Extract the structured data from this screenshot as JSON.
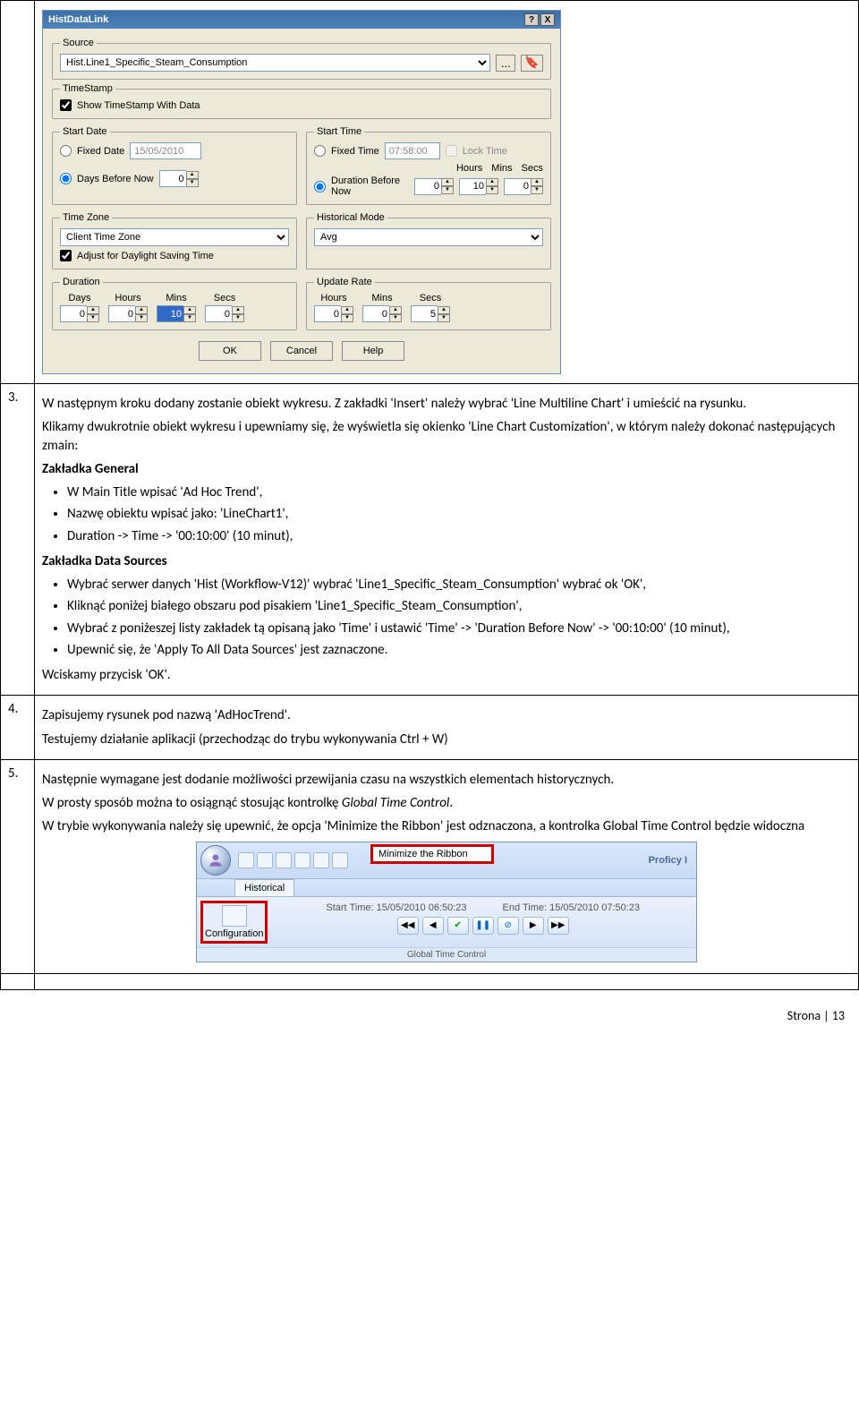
{
  "rows": {
    "r3": {
      "num": "3.",
      "intro": "W następnym kroku dodany zostanie obiekt wykresu. Z zakładki 'Insert' należy wybrać 'Line Multiline Chart' i umieścić na rysunku.",
      "p2": "Klikamy dwukrotnie obiekt wykresu i upewniamy się, że wyświetla się okienko 'Line Chart Customization', w którym należy dokonać następujących zmain:",
      "h_general": "Zakładka General",
      "gen_b1": "W Main Title wpisać 'Ad Hoc Trend',",
      "gen_b2": "Nazwę obiektu wpisać jako: 'LineChart1',",
      "gen_b3": "Duration -> Time -> '00:10:00' (10 minut),",
      "h_ds": "Zakładka Data Sources",
      "ds_b1": "Wybrać serwer danych 'Hist (Workflow-V12)' wybrać 'Line1_Specific_Steam_Consumption' wybrać ok 'OK',",
      "ds_b2": "Kliknąć poniżej białego obszaru pod pisakiem 'Line1_Specific_Steam_Consumption',",
      "ds_b3": "Wybrać z poniżeszej listy zakładek tą opisaną jako 'Time' i ustawić 'Time' -> 'Duration Before Now' -> '00:10:00' (10 minut),",
      "ds_b4": "Upewnić się, że 'Apply To All Data Sources' jest zaznaczone.",
      "ok": "Wciskamy przycisk 'OK'."
    },
    "r4": {
      "num": "4.",
      "p1": "Zapisujemy rysunek pod nazwą 'AdHocTrend'.",
      "p2": "Testujemy działanie aplikacji (przechodząc do trybu wykonywania Ctrl + W)"
    },
    "r5": {
      "num": "5.",
      "p1": "Następnie wymagane jest  dodanie możliwości przewijania czasu na wszystkich elementach historycznych.",
      "p2a": "W prosty sposób można to osiągnąć stosując kontrolkę ",
      "p2b": "Global Time Control",
      "p2c": ".",
      "p3": "W trybie wykonywania należy się upewnić, że opcja 'Minimize the Ribbon' jest odznaczona, a kontrolka Global Time Control będzie widoczna"
    }
  },
  "dialog": {
    "title": "HistDataLink",
    "help": "?",
    "close": "X",
    "grp_source": "Source",
    "source_val": "Hist.Line1_Specific_Steam_Consumption",
    "grp_ts": "TimeStamp",
    "ts_show": "Show TimeStamp With Data",
    "grp_sd": "Start Date",
    "sd_fixed": "Fixed Date",
    "sd_fixed_val": "15/05/2010",
    "sd_days": "Days Before Now",
    "sd_days_val": "0",
    "grp_st": "Start Time",
    "st_fixed": "Fixed Time",
    "st_fixed_val": "07:58:00",
    "st_lock": "Lock Time",
    "st_dur": "Duration Before Now",
    "hours": "Hours",
    "mins": "Mins",
    "secs": "Secs",
    "st_h": "0",
    "st_m": "10",
    "st_s": "0",
    "grp_tz": "Time Zone",
    "tz_val": "Client Time Zone",
    "tz_dst": "Adjust for Daylight Saving Time",
    "grp_hm": "Historical Mode",
    "hm_val": "Avg",
    "grp_dur": "Duration",
    "days": "Days",
    "d_d": "0",
    "d_h": "0",
    "d_m": "10",
    "d_s": "0",
    "grp_ur": "Update Rate",
    "u_h": "0",
    "u_m": "0",
    "u_s": "5",
    "ok": "OK",
    "cancel": "Cancel",
    "helpBtn": "Help"
  },
  "ribbon": {
    "minimize": "Minimize the Ribbon",
    "brand": "Proficy I",
    "tab": "Historical",
    "config": "Configuration",
    "st": "Start Time: 15/05/2010 06:50:23",
    "et": "End Time: 15/05/2010 07:50:23",
    "panel": "Global Time Control"
  },
  "footer": "Strona | 13"
}
